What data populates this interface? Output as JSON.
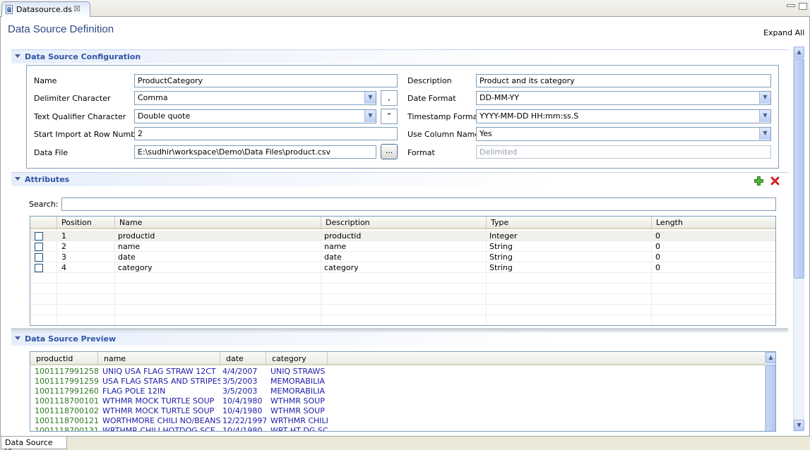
{
  "editor_tab": {
    "label": "Datasource.ds",
    "close": "☒"
  },
  "page": {
    "title": "Data Source Definition",
    "expand_all": "Expand All"
  },
  "config": {
    "section_title": "Data Source Configuration",
    "name_label": "Name",
    "name_value": "ProductCategory",
    "delimiter_label": "Delimiter Character",
    "delimiter_value": "Comma",
    "delimiter_char": ",",
    "qualifier_label": "Text Qualifier Character",
    "qualifier_value": "Double quote",
    "qualifier_char": "\"",
    "start_row_label": "Start Import at Row Number",
    "start_row_value": "2",
    "data_file_label": "Data File",
    "data_file_value": "E:\\sudhir\\workspace\\Demo\\Data Files\\product.csv",
    "browse_label": "...",
    "description_label": "Description",
    "description_value": "Product and its category",
    "date_format_label": "Date Format",
    "date_format_value": "DD-MM-YY",
    "timestamp_label": "Timestamp Format",
    "timestamp_value": "YYYY-MM-DD HH:mm:ss.S",
    "use_columns_label": "Use Column Names",
    "use_columns_value": "Yes",
    "format_label": "Format",
    "format_value": "Delimited"
  },
  "attributes": {
    "section_title": "Attributes",
    "search_label": "Search:",
    "columns": [
      "Position",
      "Name",
      "Description",
      "Type",
      "Length"
    ],
    "rows": [
      {
        "position": "1",
        "name": "productid",
        "description": "productid",
        "type": "Integer",
        "length": "0"
      },
      {
        "position": "2",
        "name": "name",
        "description": "name",
        "type": "String",
        "length": "0"
      },
      {
        "position": "3",
        "name": "date",
        "description": "date",
        "type": "String",
        "length": "0"
      },
      {
        "position": "4",
        "name": "category",
        "description": "category",
        "type": "String",
        "length": "0"
      }
    ]
  },
  "preview": {
    "section_title": "Data Source Preview",
    "columns": [
      "productid",
      "name",
      "date",
      "category"
    ],
    "rows": [
      [
        "1001117991258",
        "UNIQ USA FLAG STRAW 12CT",
        "4/4/2007",
        "UNIQ STRAWS"
      ],
      [
        "1001117991259",
        "USA FLAG STARS AND STRIPES",
        "3/5/2003",
        "MEMORABILIA"
      ],
      [
        "1001117991260",
        "FLAG POLE 12IN",
        "3/5/2003",
        "MEMORABILIA"
      ],
      [
        "1001118700101",
        "WTHMR MOCK TURTLE SOUP",
        "10/4/1980",
        "WTHMR SOUP"
      ],
      [
        "1001118700102",
        "WTHMR MOCK TURTLE SOUP",
        "10/4/1980",
        "WTHMR SOUP"
      ],
      [
        "1001118700121",
        "WORTHMORE CHILI NO/BEANS",
        "12/22/1997",
        "WRTHMR CHILI"
      ],
      [
        "1001118700131",
        "WRTHMR CHILI HOTDOG SCE",
        "10/4/1980",
        "WRT HT DG SC"
      ]
    ]
  },
  "bottom_tab": {
    "label": "Data Source View"
  },
  "colors": {
    "title": "#2b4a86",
    "section": "#2f55a4",
    "id_text": "#2c7a1f",
    "value_text": "#1b1ba8"
  }
}
